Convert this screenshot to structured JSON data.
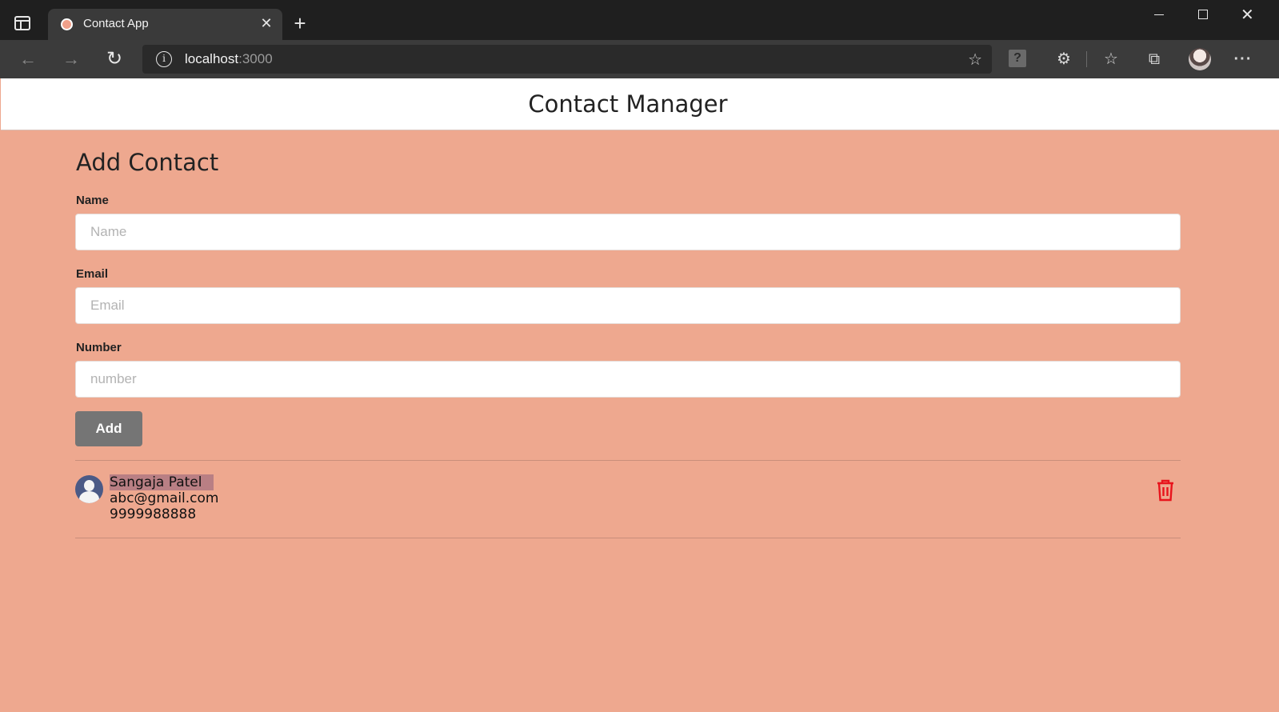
{
  "browser": {
    "tab_title": "Contact App",
    "tab_close": "✕",
    "new_tab": "+",
    "url_host": "localhost",
    "url_port": ":3000",
    "icons": [
      "sidebar-icon",
      "back-icon",
      "forward-icon",
      "reload-icon",
      "info-icon",
      "add-favorite-icon",
      "help-icon",
      "extensions-icon",
      "favorites-icon",
      "collections-icon",
      "profile-avatar",
      "more-icon"
    ]
  },
  "header": {
    "title": "Contact Manager"
  },
  "form": {
    "title": "Add Contact",
    "fields": [
      {
        "label": "Name",
        "placeholder": "Name",
        "value": ""
      },
      {
        "label": "Email",
        "placeholder": "Email",
        "value": ""
      },
      {
        "label": "Number",
        "placeholder": "number",
        "value": ""
      }
    ],
    "submit_label": "Add"
  },
  "contacts": [
    {
      "name": "Sangaja Patel",
      "email": "abc@gmail.com",
      "number": "9999988888"
    }
  ],
  "colors": {
    "page_background": "#eea88f",
    "button": "#757575",
    "delete_icon": "#e8141c",
    "avatar": "#4b5a86"
  }
}
